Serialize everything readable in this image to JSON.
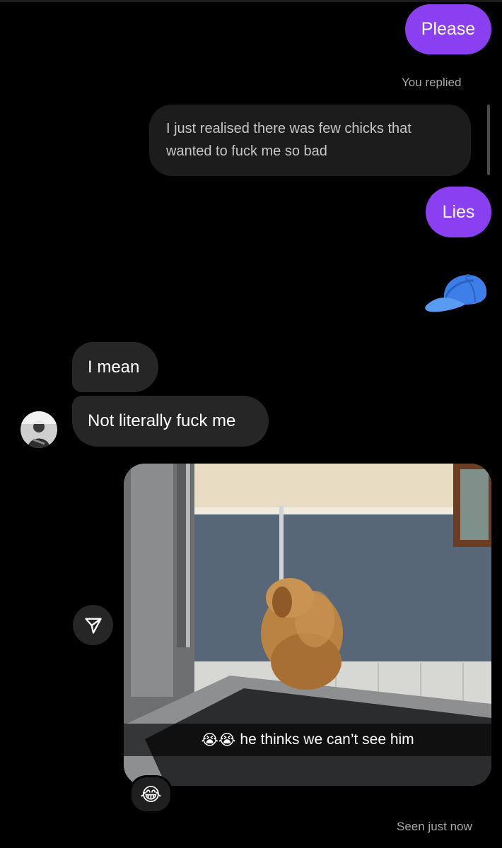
{
  "messages": {
    "please": "Please",
    "you_replied": "You replied",
    "replied_text": "I just realised there was few chicks that wanted to fuck me so bad",
    "lies": "Lies",
    "i_mean": "I mean",
    "not_literally": "Not literally fuck me",
    "photo_caption": "he thinks we can’t see him",
    "caption_emoji": "😭😭",
    "reaction": "😂",
    "seen": "Seen just now"
  },
  "icons": {
    "cap": "blue-cap-emoji",
    "share": "paper-plane-icon"
  },
  "colors": {
    "sent_bubble": "#8a3ff0",
    "received_bubble": "#262626",
    "background": "#000000"
  }
}
